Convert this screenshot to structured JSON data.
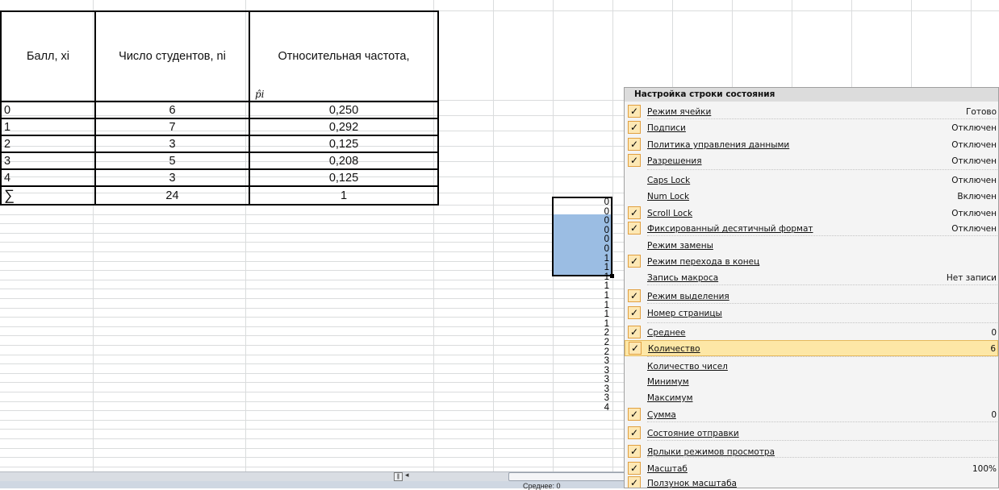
{
  "table": {
    "headers": [
      "Балл, xi",
      "Число студентов, ni",
      "Относительная частота,"
    ],
    "pi_symbol": "p̂i",
    "rows": [
      [
        "0",
        "6",
        "0,250"
      ],
      [
        "1",
        "7",
        "0,292"
      ],
      [
        "2",
        "3",
        "0,125"
      ],
      [
        "3",
        "5",
        "0,208"
      ],
      [
        "4",
        "3",
        "0,125"
      ],
      [
        "∑",
        "24",
        "1"
      ]
    ]
  },
  "column_values": [
    "0",
    "0",
    "0",
    "0",
    "0",
    "0",
    "1",
    "1",
    "1",
    "1",
    "1",
    "1",
    "1",
    "1",
    "2",
    "2",
    "2",
    "3",
    "3",
    "3",
    "3",
    "3",
    "4"
  ],
  "status_bar": {
    "text": "Среднее: 0"
  },
  "menu": {
    "title": "Настройка строки состояния",
    "items": [
      {
        "label": "Режим ячейки",
        "value": "Готово",
        "checked": true
      },
      {
        "label": "Подписи",
        "value": "Отключен",
        "checked": true
      },
      {
        "label": "Политика управления данными",
        "value": "Отключен",
        "checked": true
      },
      {
        "label": "Разрешения",
        "value": "Отключен",
        "checked": true
      },
      {
        "label": "Caps Lock",
        "value": "Отключен",
        "checked": false
      },
      {
        "label": "Num Lock",
        "value": "Включен",
        "checked": false
      },
      {
        "label": "Scroll Lock",
        "value": "Отключен",
        "checked": true
      },
      {
        "label": "Фиксированный десятичный формат",
        "value": "Отключен",
        "checked": true
      },
      {
        "label": "Режим замены",
        "value": "",
        "checked": false
      },
      {
        "label": "Режим перехода  в конец",
        "value": "",
        "checked": true
      },
      {
        "label": "Запись макроса",
        "value": "Нет записи",
        "checked": false
      },
      {
        "label": "Режим выделения",
        "value": "",
        "checked": true
      },
      {
        "label": "Номер страницы",
        "value": "",
        "checked": true
      },
      {
        "label": "Среднее",
        "value": "0",
        "checked": true
      },
      {
        "label": "Количество",
        "value": "6",
        "checked": true,
        "highlighted": true
      },
      {
        "label": "Количество чисел",
        "value": "",
        "checked": false
      },
      {
        "label": "Минимум",
        "value": "",
        "checked": false
      },
      {
        "label": "Максимум",
        "value": "",
        "checked": false
      },
      {
        "label": "Сумма",
        "value": "0",
        "checked": true
      },
      {
        "label": "Состояние отправки",
        "value": "",
        "checked": true
      },
      {
        "label": "Ярлыки режимов просмотра",
        "value": "",
        "checked": true
      },
      {
        "label": "Масштаб",
        "value": "100%",
        "checked": true
      },
      {
        "label": "Ползунок масштаба",
        "value": "",
        "checked": true
      }
    ]
  }
}
